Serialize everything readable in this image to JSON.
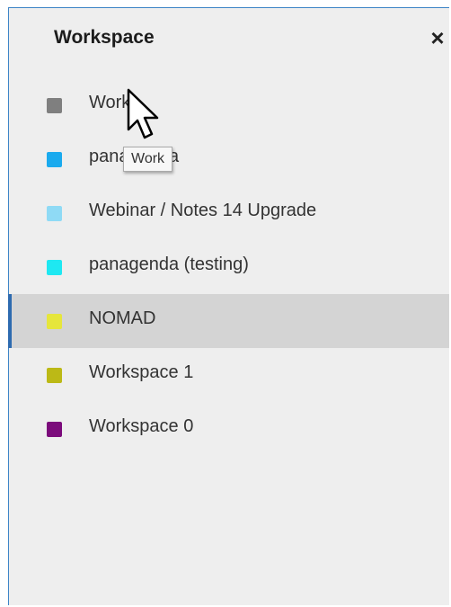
{
  "panel": {
    "title": "Workspace",
    "close_icon": "close-icon"
  },
  "workspaces": [
    {
      "label": "Work",
      "color": "#7f7f7f"
    },
    {
      "label": "panagenda",
      "color": "#1aaaee"
    },
    {
      "label": "Webinar / Notes 14 Upgrade",
      "color": "#8fdaf5"
    },
    {
      "label": "panagenda (testing)",
      "color": "#1ee8f2"
    },
    {
      "label": "NOMAD",
      "color": "#e6e63c",
      "selected": true
    },
    {
      "label": "Workspace 1",
      "color": "#bcb916"
    },
    {
      "label": "Workspace 0",
      "color": "#7b0b7b"
    }
  ],
  "tooltip": {
    "text": "Work"
  },
  "colors": {
    "accent": "#2e6bb0",
    "panel_border": "#3d84c6",
    "selected_bg": "#d4d4d4"
  }
}
